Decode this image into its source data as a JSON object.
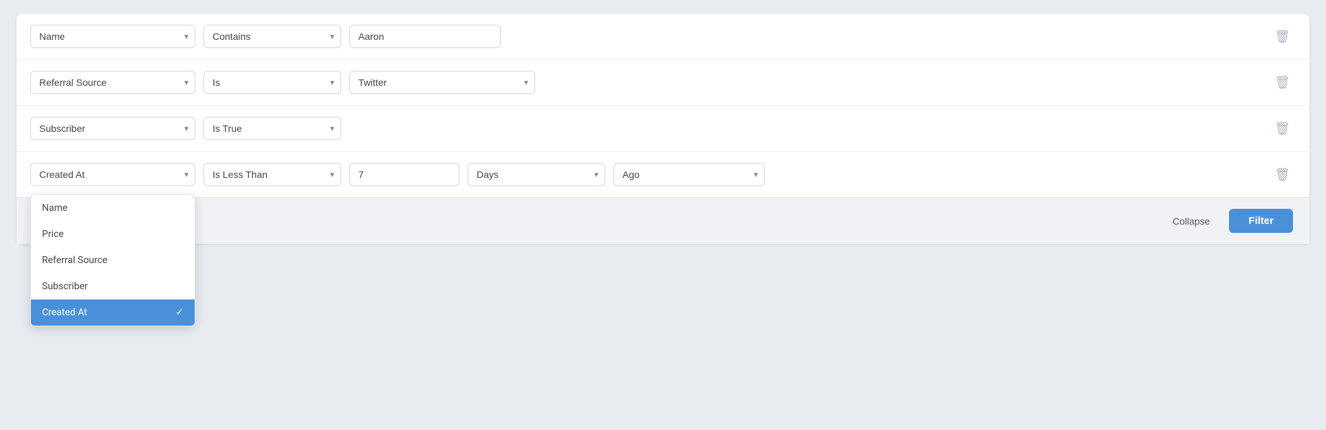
{
  "filters": {
    "rows": [
      {
        "id": "row-1",
        "field": "Name",
        "operator": "Contains",
        "valueType": "input",
        "inputValue": "Aaron"
      },
      {
        "id": "row-2",
        "field": "Referral Source",
        "operator": "Is",
        "valueType": "select",
        "selectValue": "Twitter"
      },
      {
        "id": "row-3",
        "field": "Subscriber",
        "operator": "Is True",
        "valueType": "none"
      },
      {
        "id": "row-4",
        "field": "Created At",
        "operator": "Is Less Than",
        "valueType": "date",
        "inputValue": "7",
        "unit": "Days",
        "timeframe": "Ago"
      }
    ],
    "fieldOptions": [
      "Name",
      "Price",
      "Referral Source",
      "Subscriber",
      "Created At"
    ],
    "selectedField": "Created At",
    "footer": {
      "collapseLabel": "Collapse",
      "filterLabel": "Filter"
    }
  }
}
